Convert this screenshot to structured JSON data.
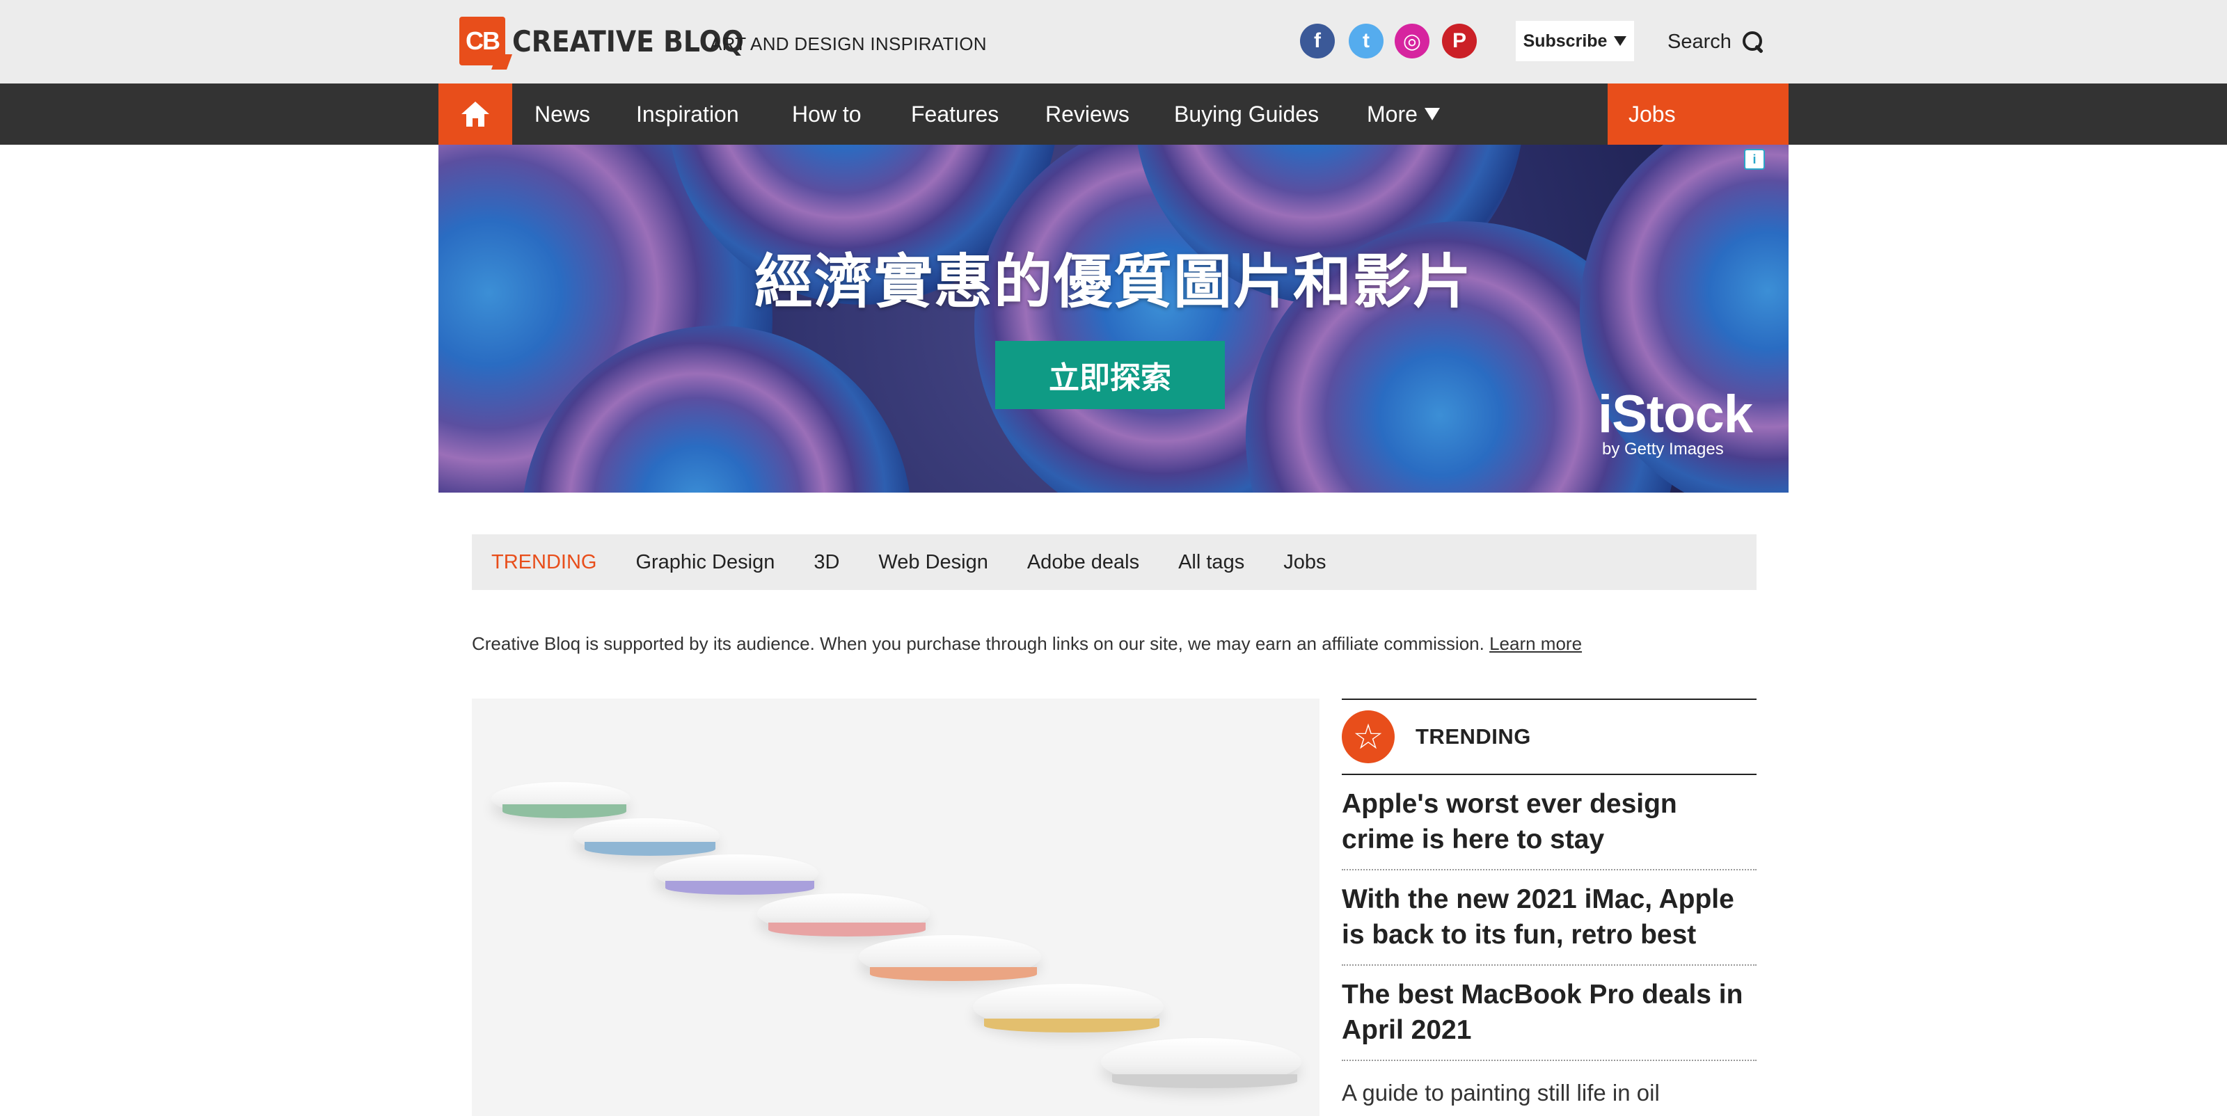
{
  "header": {
    "logo_mark": "CB",
    "logo_text": "CREATIVE BLOQ",
    "tagline": "ART AND DESIGN INSPIRATION",
    "social": [
      {
        "icon": "facebook-icon",
        "glyph": "f"
      },
      {
        "icon": "twitter-icon",
        "glyph": "t"
      },
      {
        "icon": "instagram-icon",
        "glyph": "◎"
      },
      {
        "icon": "pinterest-icon",
        "glyph": "P"
      }
    ],
    "subscribe_label": "Subscribe",
    "search_label": "Search"
  },
  "nav": {
    "items": [
      "News",
      "Inspiration",
      "How to",
      "Features",
      "Reviews",
      "Buying Guides",
      "More"
    ],
    "jobs_label": "Jobs"
  },
  "ad": {
    "headline": "經濟實惠的優質圖片和影片",
    "cta": "立即探索",
    "brand": "iStock",
    "brand_sub": "by Getty Images",
    "info_glyph": "i"
  },
  "tags": {
    "trending_label": "TRENDING",
    "items": [
      "Graphic Design",
      "3D",
      "Web Design",
      "Adobe deals",
      "All tags",
      "Jobs"
    ]
  },
  "affiliate": {
    "text": "Creative Bloq is supported by its audience. When you purchase through links on our site, we may earn an affiliate commission.",
    "link": "Learn more"
  },
  "trending": {
    "title": "TRENDING",
    "star_glyph": "☆",
    "items": [
      "Apple's worst ever design crime is here to stay",
      "With the new 2021 iMac, Apple is back to its fun, retro best",
      "The best MacBook Pro deals in April 2021",
      "A guide to painting still life in oil"
    ]
  },
  "colors": {
    "accent": "#e84e1b",
    "nav_bg": "#333333",
    "header_bg": "#ececec",
    "ad_cta": "#0f9b85"
  }
}
